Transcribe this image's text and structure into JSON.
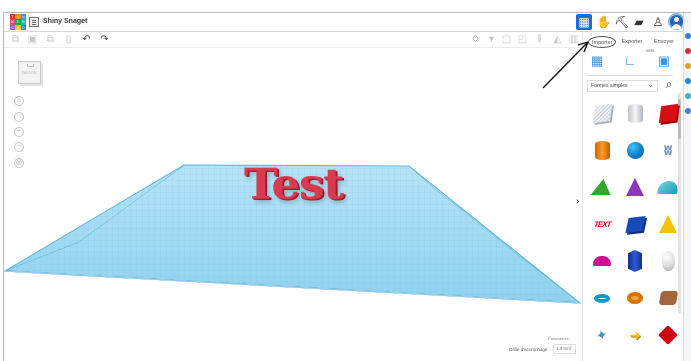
{
  "app": {
    "project_title": "Shiny Snaget"
  },
  "logo": {
    "cells": [
      "T",
      "I",
      "N",
      "K",
      "E",
      "R",
      "C",
      "A",
      "D"
    ],
    "colors": [
      "#e5302c",
      "#f28d20",
      "#2a8df2",
      "#e94a77",
      "#16a34a",
      "#14b8c5",
      "#9b5de5",
      "#f4c21b",
      "#1687d9"
    ]
  },
  "top_icons": [
    {
      "name": "grid-view-icon",
      "symbol": "▦"
    },
    {
      "name": "hand-icon",
      "symbol": "✋"
    },
    {
      "name": "hammer-pick-icon",
      "symbol": "⛏"
    },
    {
      "name": "bricks-icon",
      "symbol": "▰"
    },
    {
      "name": "add-user-icon",
      "symbol": "♙"
    }
  ],
  "toolbar": {
    "tools": [
      {
        "name": "copy-icon",
        "symbol": "⧉"
      },
      {
        "name": "paste-icon",
        "symbol": "▣"
      },
      {
        "name": "duplicate-icon",
        "symbol": "⧉"
      },
      {
        "name": "delete-icon",
        "symbol": "▯"
      },
      {
        "name": "undo-icon",
        "symbol": "↶"
      },
      {
        "name": "redo-icon",
        "symbol": "↷"
      },
      {
        "name": "light-bulb-icon",
        "symbol": "♢"
      },
      {
        "name": "visibility-dropdown-icon",
        "symbol": "▾"
      },
      {
        "name": "group-icon",
        "symbol": "▢"
      },
      {
        "name": "ungroup-icon",
        "symbol": "◰"
      },
      {
        "name": "align-icon",
        "symbol": "⫴"
      },
      {
        "name": "mirror-icon",
        "symbol": "◭"
      },
      {
        "name": "ruler-icon",
        "symbol": "▥"
      }
    ]
  },
  "viewport": {
    "view_cube_label": "DROITE",
    "controls": [
      {
        "name": "home-view-icon",
        "symbol": "⌂"
      },
      {
        "name": "fit-view-icon",
        "symbol": "◌"
      },
      {
        "name": "zoom-in-icon",
        "symbol": "+"
      },
      {
        "name": "zoom-out-icon",
        "symbol": "−"
      },
      {
        "name": "perspective-icon",
        "symbol": "◎"
      }
    ],
    "model_text": "Test",
    "params_label": "Paramètres",
    "grid_label": "Grille d'accrochage",
    "grid_value": "1.0 mm"
  },
  "panel": {
    "tabs": [
      "Importer",
      "Exporter",
      "Envoyer"
    ],
    "tab_suffix": "vers",
    "views": [
      {
        "name": "workplane-view-icon",
        "symbol": "▦"
      },
      {
        "name": "ruler-view-icon",
        "symbol": "∟"
      },
      {
        "name": "notes-view-icon",
        "symbol": "▣"
      }
    ],
    "shape_category": "Formes simples",
    "shapes": [
      {
        "name": "box-shape",
        "class": "box-gray"
      },
      {
        "name": "cylinder-shape",
        "class": "cyl-gray"
      },
      {
        "name": "red-box-shape",
        "class": "red-box"
      },
      {
        "name": "orange-cylinder-shape",
        "class": "orange-cyl"
      },
      {
        "name": "sphere-shape",
        "class": "blue-sphere"
      },
      {
        "name": "scribble-shape",
        "class": "scribble",
        "symbol": "ʬ"
      },
      {
        "name": "roof-shape",
        "class": "green-roof"
      },
      {
        "name": "cone-shape",
        "class": "purple-cone"
      },
      {
        "name": "round-roof-shape",
        "class": "teal-dome"
      },
      {
        "name": "text-shape",
        "class": "red-text-shape",
        "symbol": "TEXT"
      },
      {
        "name": "box-shape-navy",
        "class": "navy-box"
      },
      {
        "name": "pyramid-shape",
        "class": "yellow-pyramid"
      },
      {
        "name": "half-sphere-shape",
        "class": "magenta-half"
      },
      {
        "name": "polygon-shape",
        "class": "blue-prism"
      },
      {
        "name": "paraboloid-shape",
        "class": "white-egg"
      },
      {
        "name": "torus-shape",
        "class": "teal-ring"
      },
      {
        "name": "tube-shape",
        "class": "orange-ring"
      },
      {
        "name": "wedge-shape",
        "class": "brown-rock"
      },
      {
        "name": "star-shape",
        "class": "star",
        "symbol": "✦"
      },
      {
        "name": "arrow-shape",
        "class": "arrow-shape",
        "symbol": "➜"
      },
      {
        "name": "gem-shape",
        "class": "red-gem"
      }
    ]
  },
  "rail_colors": [
    "#2d7ce2",
    "#cc3333",
    "#e79b1f",
    "#158cde",
    "#3bb2d0",
    "#4d7bd1"
  ]
}
